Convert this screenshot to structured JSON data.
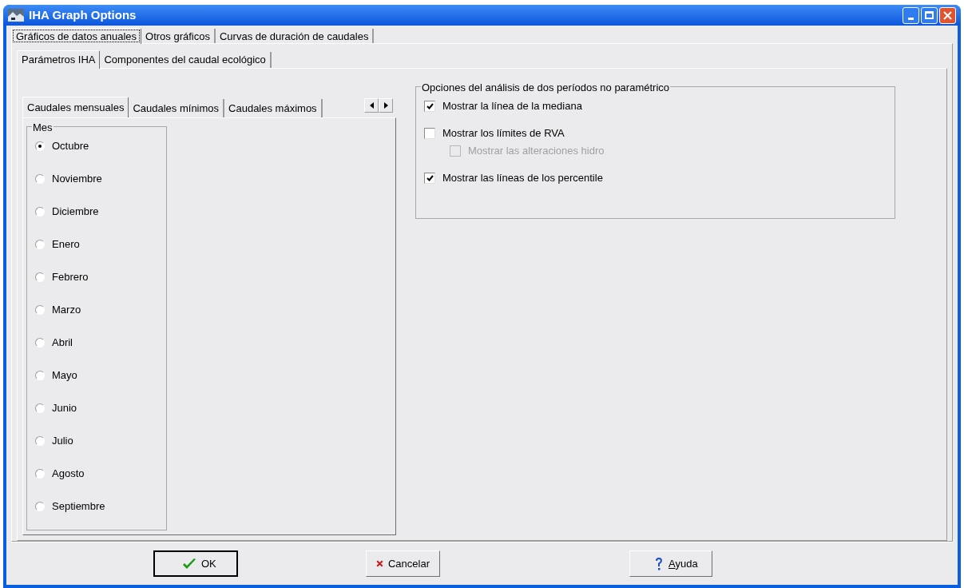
{
  "window": {
    "title": "IHA Graph Options"
  },
  "outer_tabs": [
    {
      "label": "Gráficos de datos anuales",
      "selected": true
    },
    {
      "label": "Otros gráficos",
      "selected": false
    },
    {
      "label": "Curvas de duración de caudales",
      "selected": false
    }
  ],
  "param_tabs": [
    {
      "label": "Parámetros IHA",
      "selected": true
    },
    {
      "label": "Componentes del caudal ecológico",
      "selected": false
    }
  ],
  "flow_tabs": [
    {
      "label": "Caudales mensuales",
      "selected": true
    },
    {
      "label": "Caudales mínimos",
      "selected": false
    },
    {
      "label": "Caudales máximos",
      "selected": false
    }
  ],
  "month_group": {
    "title": "Mes",
    "options": [
      {
        "label": "Octubre",
        "selected": true
      },
      {
        "label": "Noviembre",
        "selected": false
      },
      {
        "label": "Diciembre",
        "selected": false
      },
      {
        "label": "Enero",
        "selected": false
      },
      {
        "label": "Febrero",
        "selected": false
      },
      {
        "label": "Marzo",
        "selected": false
      },
      {
        "label": "Abril",
        "selected": false
      },
      {
        "label": "Mayo",
        "selected": false
      },
      {
        "label": "Junio",
        "selected": false
      },
      {
        "label": "Julio",
        "selected": false
      },
      {
        "label": "Agosto",
        "selected": false
      },
      {
        "label": "Septiembre",
        "selected": false
      }
    ]
  },
  "options_group": {
    "title": "Opciones del análisis de dos períodos no paramétrico",
    "items": [
      {
        "label": "Mostrar la línea de la mediana",
        "checked": true,
        "disabled": false
      },
      {
        "label": "Mostrar los límites de RVA",
        "checked": false,
        "disabled": false,
        "children": [
          {
            "label": "Mostrar las alteraciones hidro",
            "checked": false,
            "disabled": true
          }
        ]
      },
      {
        "label": "Mostrar las líneas de los percentile",
        "checked": true,
        "disabled": false
      }
    ]
  },
  "buttons": [
    {
      "label": "OK",
      "kind": "ok",
      "default": true,
      "access_key_underlined": false
    },
    {
      "label": "Cancelar",
      "kind": "cancel",
      "default": false,
      "access_key_underlined": false
    },
    {
      "label": "Ayuda",
      "kind": "help",
      "default": false,
      "access_key_underlined": true
    }
  ]
}
